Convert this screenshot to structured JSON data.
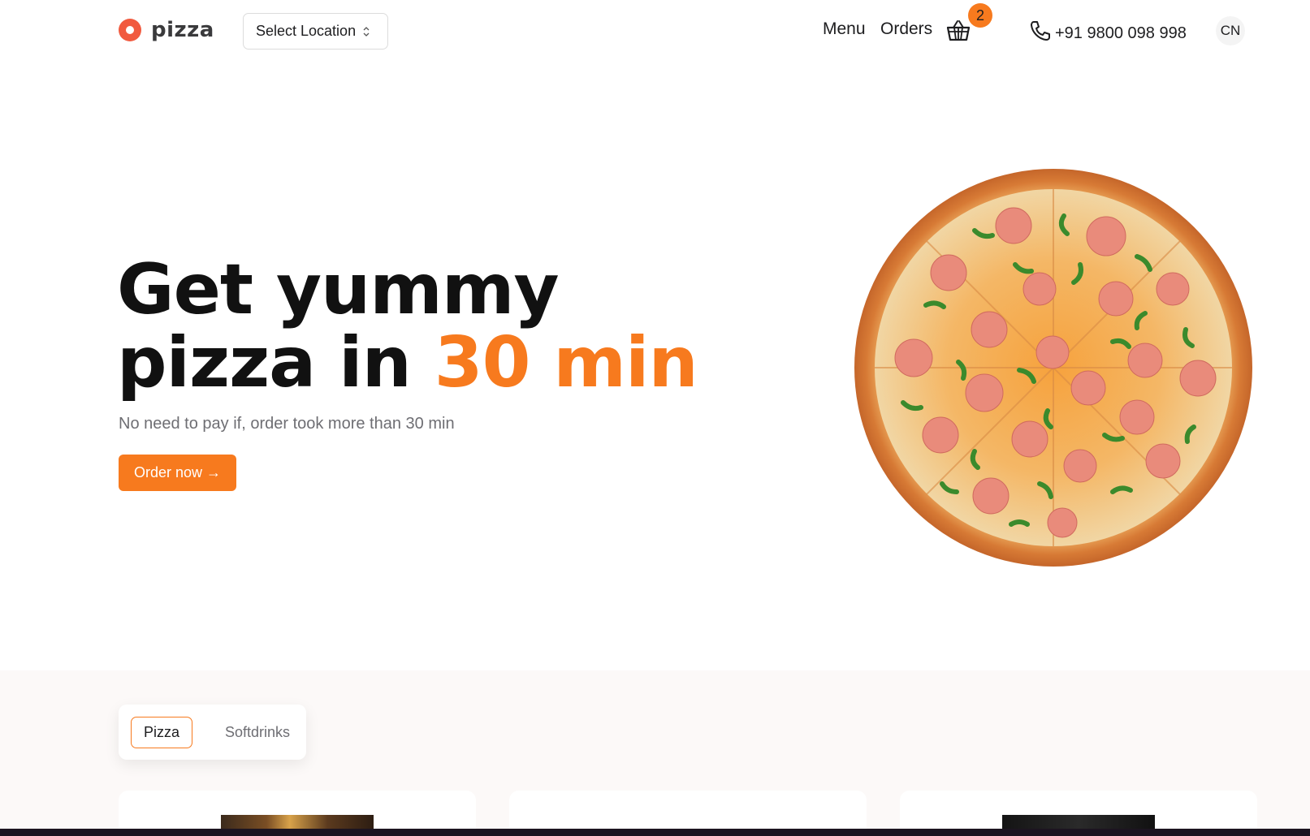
{
  "brand": {
    "name": "pizza",
    "accent": "#f77a1e",
    "logo_color": "#f15a3f"
  },
  "header": {
    "location_label": "Select Location",
    "nav": {
      "menu": "Menu",
      "orders": "Orders"
    },
    "cart_count": "2",
    "phone": "+91 9800 098 998",
    "language": "CN"
  },
  "hero": {
    "title_line1": "Get yummy",
    "title_line2_prefix": "pizza in ",
    "title_accent": "30 min",
    "subtitle": "No need to pay if, order took more than 30 min",
    "cta": "Order now →"
  },
  "menu": {
    "tabs": [
      {
        "label": "Pizza",
        "active": true
      },
      {
        "label": "Softdrinks",
        "active": false
      }
    ]
  },
  "icons": {
    "location_chevron": "chevron-updown-icon",
    "cart": "basket-icon",
    "phone": "phone-icon"
  }
}
